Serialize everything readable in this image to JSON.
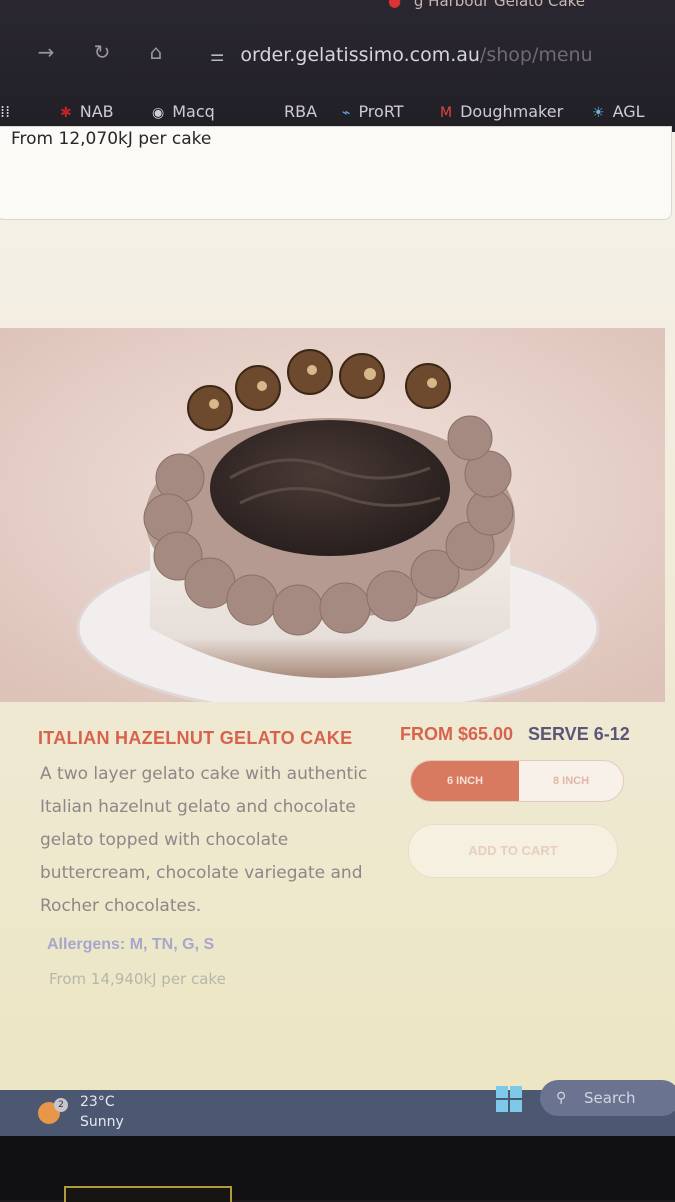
{
  "browser": {
    "tab_title": "g Harbour Gelato Cake",
    "url_domain": "order.gelatissimo.com.au",
    "url_path": "/shop/menu",
    "bookmarks": [
      {
        "label": "NAB",
        "icon": "nab-star-icon"
      },
      {
        "label": "Macq",
        "icon": "macq-circle-icon"
      },
      {
        "label": "RBA",
        "icon": ""
      },
      {
        "label": "ProRT",
        "icon": "prort-icon"
      },
      {
        "label": "Doughmaker",
        "icon": "gmail-icon"
      },
      {
        "label": "AGL",
        "icon": "agl-icon"
      }
    ]
  },
  "previous_product": {
    "energy": "From 12,070kJ per cake"
  },
  "product": {
    "title": "ITALIAN HAZELNUT GELATO CAKE",
    "price": "FROM $65.00",
    "serves": "SERVE 6-12",
    "description": "A two layer gelato cake with authentic Italian hazelnut gelato and chocolate gelato topped with chocolate buttercream, chocolate variegate and Rocher chocolates.",
    "sizes": [
      "6 INCH",
      "8 INCH"
    ],
    "selected_size": "6 INCH",
    "add_to_cart": "ADD TO CART",
    "allergens": "Allergens: M, TN, G, S",
    "energy": "From 14,940kJ per cake"
  },
  "taskbar": {
    "temperature": "23°C",
    "condition": "Sunny",
    "notification_count": "2",
    "search_label": "Search"
  },
  "colors": {
    "accent": "#d8634d",
    "serve_text": "#5b5578",
    "taskbar": "#4c5872"
  }
}
